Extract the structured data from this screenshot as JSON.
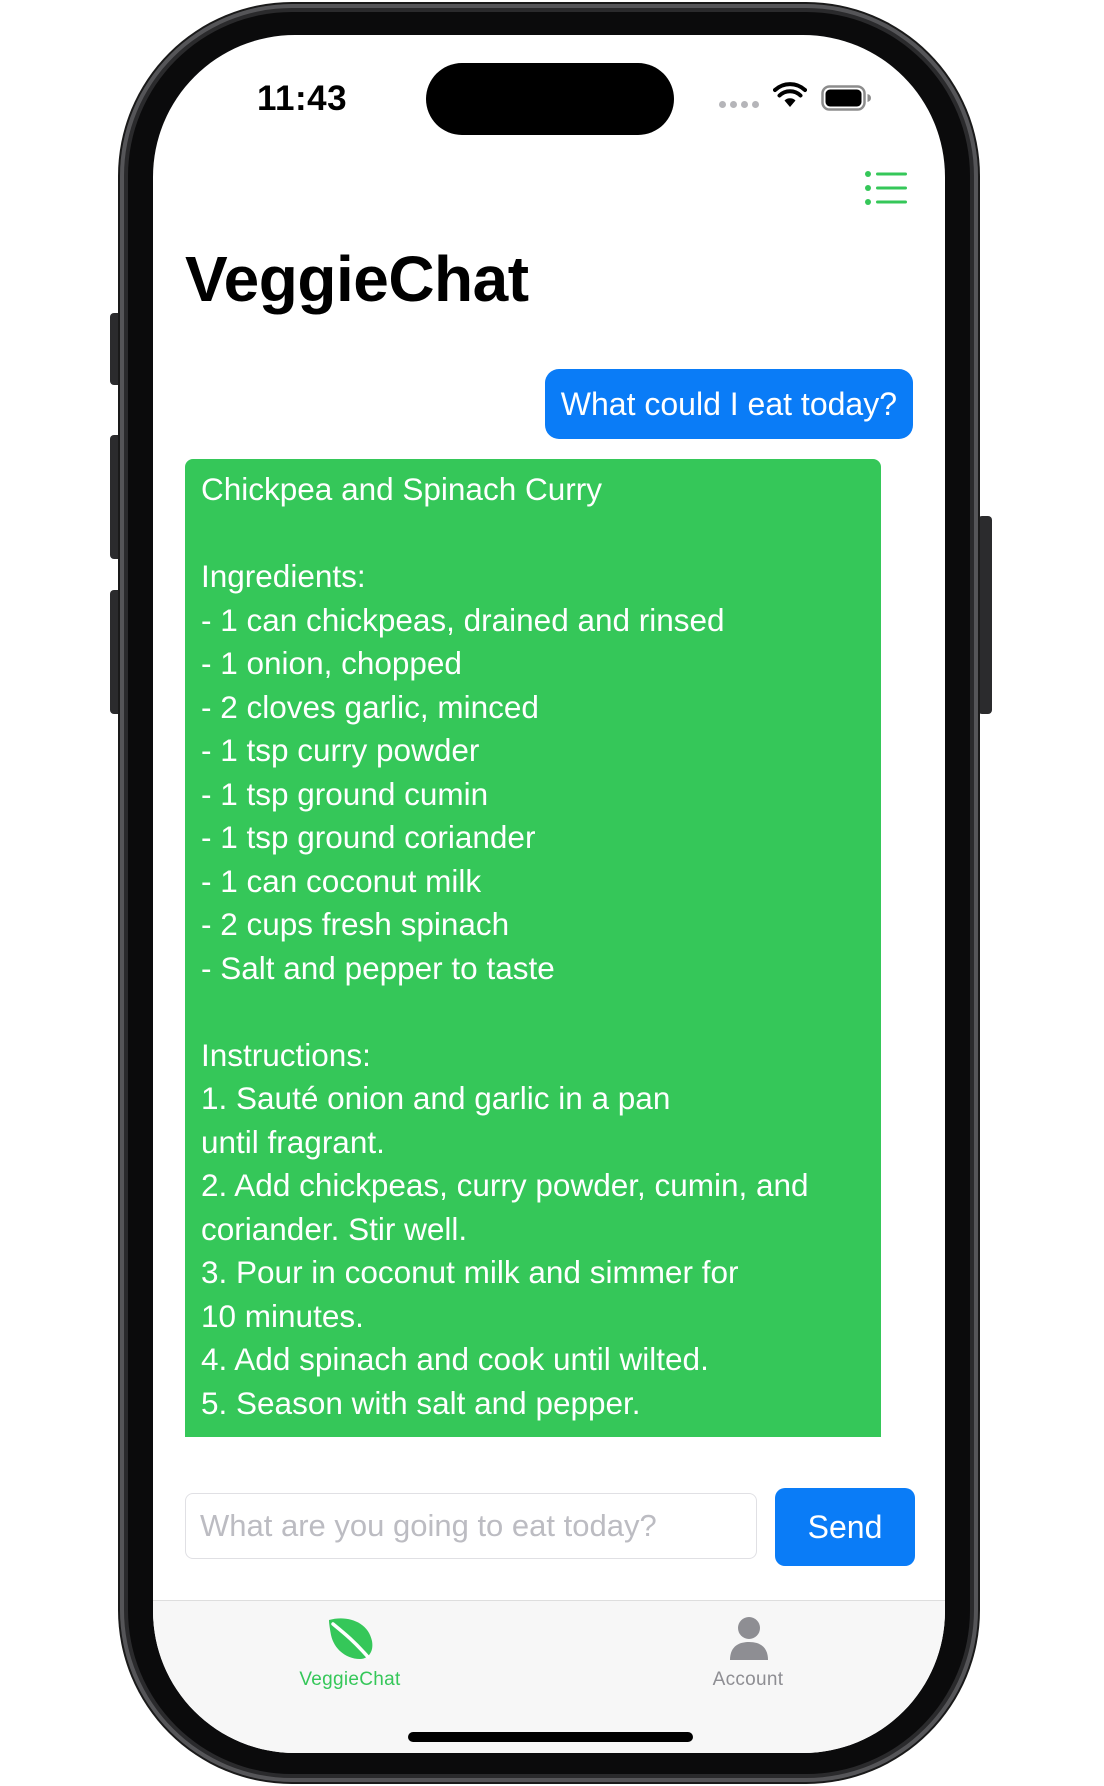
{
  "status_bar": {
    "time": "11:43"
  },
  "header": {
    "title": "VeggieChat",
    "menu_icon": "list-bullet-icon"
  },
  "colors": {
    "accent_green": "#35c759",
    "accent_blue": "#0a7cf7",
    "tab_inactive": "#8e8e93"
  },
  "chat": {
    "user_message": "What could I eat today?",
    "bot_message_lines": [
      "Chickpea and Spinach Curry",
      "",
      "Ingredients:",
      "- 1 can chickpeas, drained and rinsed",
      "- 1 onion, chopped",
      "- 2 cloves garlic, minced",
      "- 1 tsp curry powder",
      "- 1 tsp ground cumin",
      "- 1 tsp ground coriander",
      "- 1 can coconut milk",
      "- 2 cups fresh spinach",
      "- Salt and pepper to taste",
      "",
      "Instructions:",
      "1. Sauté onion and garlic in a pan",
      "until fragrant.",
      "2. Add chickpeas, curry powder, cumin, and",
      "coriander. Stir well.",
      "3. Pour in coconut milk and simmer for",
      "10 minutes.",
      "4. Add spinach and cook until wilted.",
      "5. Season with salt and pepper."
    ]
  },
  "composer": {
    "placeholder": "What are you going to eat today?",
    "value": "",
    "send_label": "Send"
  },
  "tab_bar": {
    "tabs": [
      {
        "label": "VeggieChat",
        "icon": "leaf-icon",
        "selected": true
      },
      {
        "label": "Account",
        "icon": "person-icon",
        "selected": false
      }
    ]
  }
}
